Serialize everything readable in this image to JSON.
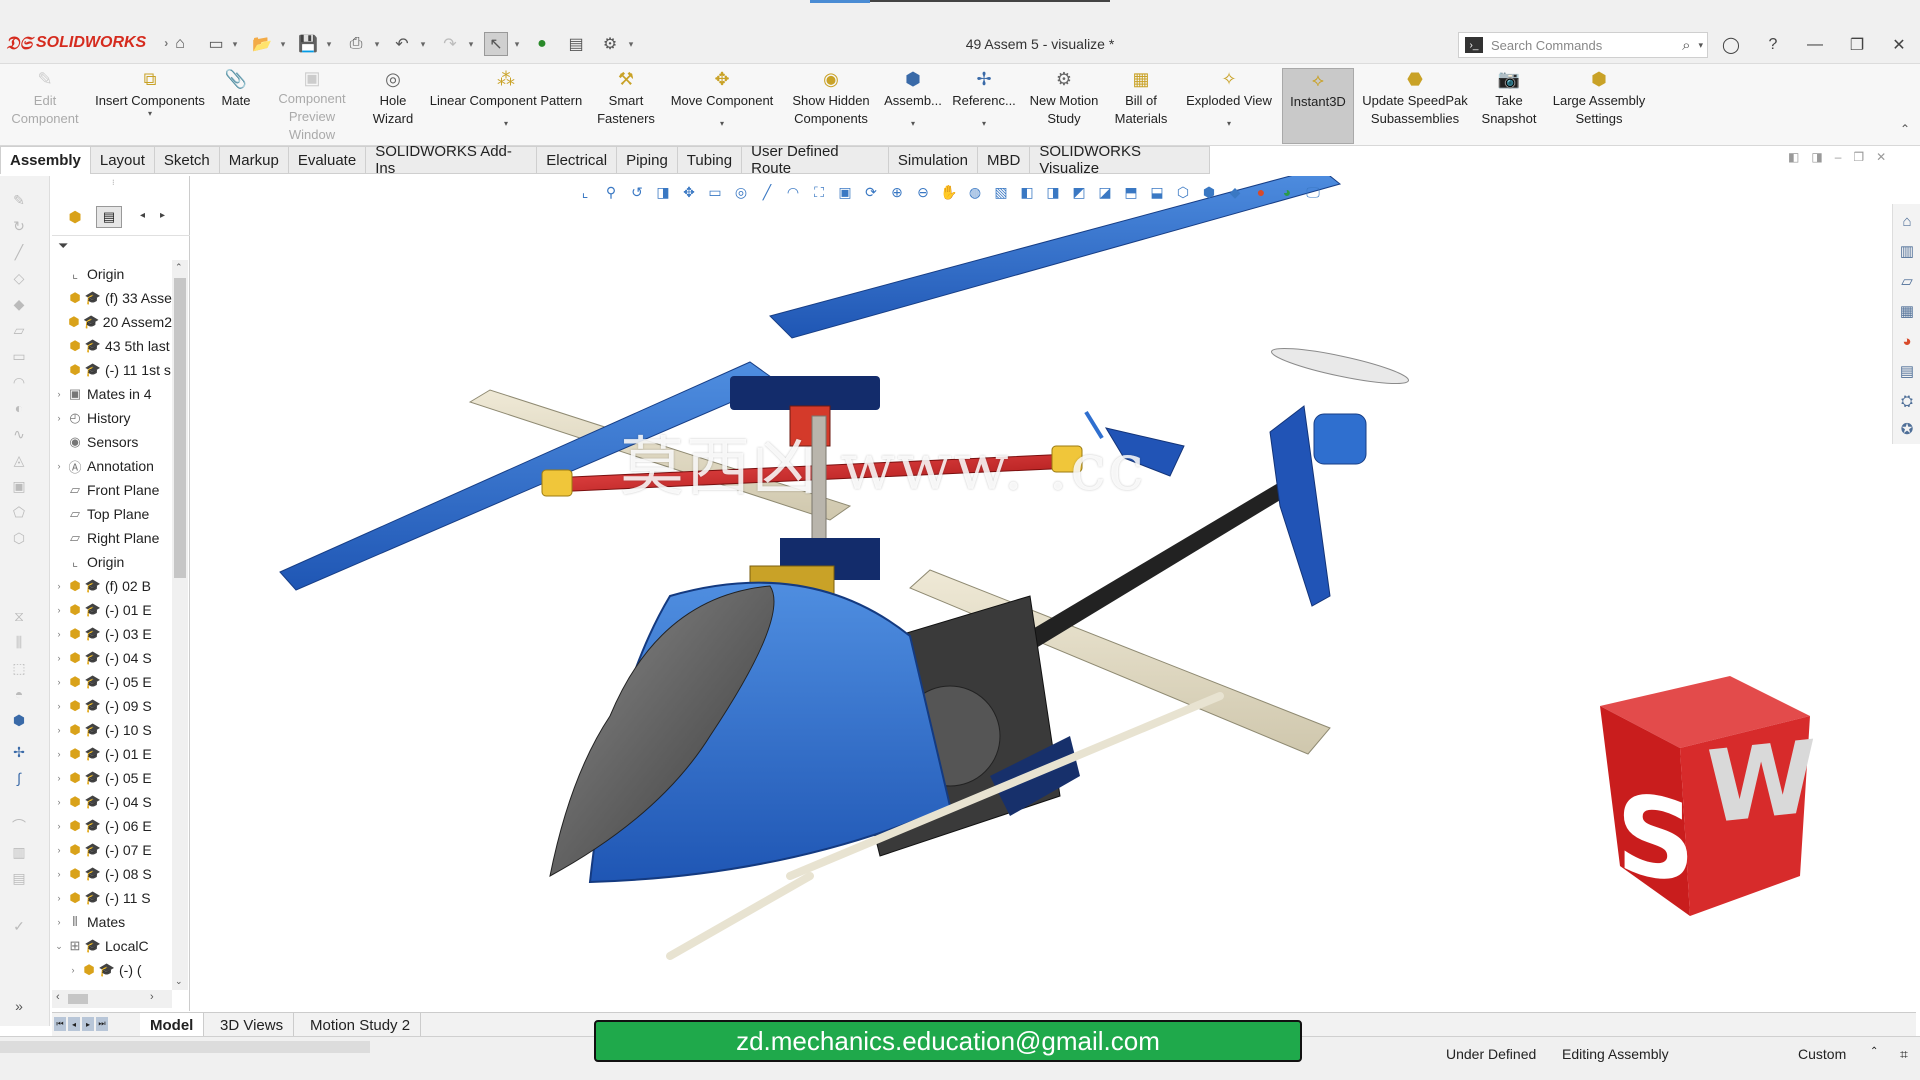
{
  "app": {
    "brand": "SOLIDWORKS",
    "document_title": "49 Assem 5 - visualize *"
  },
  "search": {
    "placeholder": "Search Commands"
  },
  "ribbon": {
    "buttons": [
      {
        "label": "Edit\nComponent",
        "icon": "edit-component-icon",
        "disabled": true
      },
      {
        "label": "Insert Components",
        "icon": "insert-components-icon"
      },
      {
        "label": "Mate",
        "icon": "mate-icon"
      },
      {
        "label": "Component\nPreview Window",
        "icon": "preview-window-icon",
        "disabled": true
      },
      {
        "label": "Hole\nWizard",
        "icon": "hole-wizard-icon"
      },
      {
        "label": "Linear Component Pattern",
        "icon": "pattern-icon"
      },
      {
        "label": "Smart\nFasteners",
        "icon": "fasteners-icon"
      },
      {
        "label": "Move Component",
        "icon": "move-icon"
      },
      {
        "label": "Show Hidden\nComponents",
        "icon": "show-hidden-icon"
      },
      {
        "label": "Assemb...",
        "icon": "assembly-features-icon"
      },
      {
        "label": "Referenc...",
        "icon": "reference-geometry-icon"
      },
      {
        "label": "New Motion\nStudy",
        "icon": "motion-study-icon"
      },
      {
        "label": "Bill of\nMaterials",
        "icon": "bom-icon"
      },
      {
        "label": "Exploded View",
        "icon": "exploded-view-icon"
      },
      {
        "label": "Instant3D",
        "icon": "instant3d-icon",
        "active": true
      },
      {
        "label": "Update SpeedPak\nSubassemblies",
        "icon": "speedpak-icon"
      },
      {
        "label": "Take\nSnapshot",
        "icon": "snapshot-icon"
      },
      {
        "label": "Large Assembly\nSettings",
        "icon": "large-assembly-icon"
      }
    ]
  },
  "tabs": [
    "Assembly",
    "Layout",
    "Sketch",
    "Markup",
    "Evaluate",
    "SOLIDWORKS Add-Ins",
    "Electrical",
    "Piping",
    "Tubing",
    "User Defined Route",
    "Simulation",
    "MBD",
    "SOLIDWORKS Visualize"
  ],
  "tree": {
    "items": [
      {
        "label": "Origin",
        "icon": "origin-icon",
        "exp": ""
      },
      {
        "label": "(f) 33 Asse",
        "icon": "assembly-icon",
        "exp": ""
      },
      {
        "label": "20 Assem2",
        "icon": "assembly-icon",
        "exp": ""
      },
      {
        "label": "43 5th last",
        "icon": "assembly-icon",
        "exp": ""
      },
      {
        "label": "(-) 11 1st s",
        "icon": "assembly-icon",
        "exp": ""
      },
      {
        "label": "Mates in 4",
        "icon": "mates-folder-icon",
        "exp": "›"
      },
      {
        "label": "History",
        "icon": "history-icon",
        "exp": "›"
      },
      {
        "label": "Sensors",
        "icon": "sensors-icon",
        "exp": ""
      },
      {
        "label": "Annotation",
        "icon": "annotations-icon",
        "exp": "›"
      },
      {
        "label": "Front Plane",
        "icon": "plane-icon",
        "exp": ""
      },
      {
        "label": "Top Plane",
        "icon": "plane-icon",
        "exp": ""
      },
      {
        "label": "Right Plane",
        "icon": "plane-icon",
        "exp": ""
      },
      {
        "label": "Origin",
        "icon": "origin-icon",
        "exp": ""
      },
      {
        "label": "(f) 02 B",
        "icon": "part-icon",
        "exp": "›"
      },
      {
        "label": "(-) 01 E",
        "icon": "part-icon",
        "exp": "›"
      },
      {
        "label": "(-) 03 E",
        "icon": "part-icon",
        "exp": "›"
      },
      {
        "label": "(-) 04 S",
        "icon": "part-icon",
        "exp": "›"
      },
      {
        "label": "(-) 05 E",
        "icon": "part-icon",
        "exp": "›"
      },
      {
        "label": "(-) 09 S",
        "icon": "part-icon",
        "exp": "›"
      },
      {
        "label": "(-) 10 S",
        "icon": "part-icon",
        "exp": "›"
      },
      {
        "label": "(-) 01 E",
        "icon": "part-icon",
        "exp": "›"
      },
      {
        "label": "(-) 05 E",
        "icon": "part-icon",
        "exp": "›"
      },
      {
        "label": "(-) 04 S",
        "icon": "part-icon",
        "exp": "›"
      },
      {
        "label": "(-) 06 E",
        "icon": "part-icon",
        "exp": "›"
      },
      {
        "label": "(-) 07 E",
        "icon": "part-icon",
        "exp": "›"
      },
      {
        "label": "(-) 08 S",
        "icon": "part-icon",
        "exp": "›"
      },
      {
        "label": "(-) 11 S",
        "icon": "part-icon",
        "exp": "›"
      },
      {
        "label": "Mates",
        "icon": "mates-icon",
        "exp": "›"
      },
      {
        "label": "LocalC",
        "icon": "pattern-icon",
        "exp": "⌄"
      },
      {
        "label": "(-) (",
        "icon": "part-icon",
        "exp": "›"
      }
    ]
  },
  "bottom_tabs": [
    "Model",
    "3D Views",
    "Motion Study 2"
  ],
  "status": {
    "state": "Under Defined",
    "mode": "Editing Assembly",
    "units": "Custom"
  },
  "overlay": {
    "email": "zd.mechanics.education@gmail.com",
    "watermark": "莫西凶 www.  .cc"
  },
  "colors": {
    "brand_red": "#d52b1e",
    "rotor_blue": "#2f6fcf",
    "email_bg": "#1fa94b"
  }
}
